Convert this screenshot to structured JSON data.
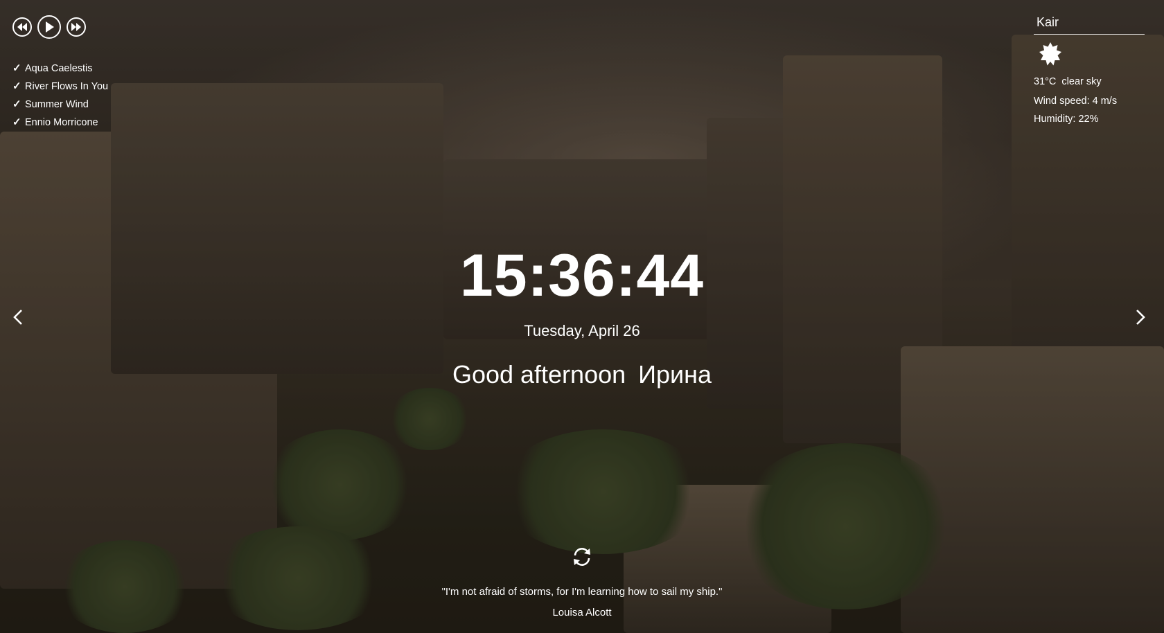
{
  "player": {
    "buttons": [
      "prev-icon",
      "play-icon",
      "next-icon"
    ],
    "playlist": [
      {
        "title": "Aqua Caelestis"
      },
      {
        "title": "River Flows In You"
      },
      {
        "title": "Summer Wind"
      },
      {
        "title": "Ennio Morricone"
      }
    ]
  },
  "weather": {
    "city": "Kair",
    "icon": "sun-icon",
    "temperature": "31°C",
    "description": "clear sky",
    "wind": "Wind speed: 4 m/s",
    "humidity": "Humidity: 22%"
  },
  "clock": {
    "time": "15:36:44",
    "date": "Tuesday, April 26"
  },
  "greeting": {
    "text": "Good afternoon",
    "name": "Ирина"
  },
  "quote": {
    "text": "\"I'm not afraid of storms, for I'm learning how to sail my ship.\"",
    "author": "Louisa Alcott"
  },
  "colors": {
    "text": "#ffffff"
  }
}
